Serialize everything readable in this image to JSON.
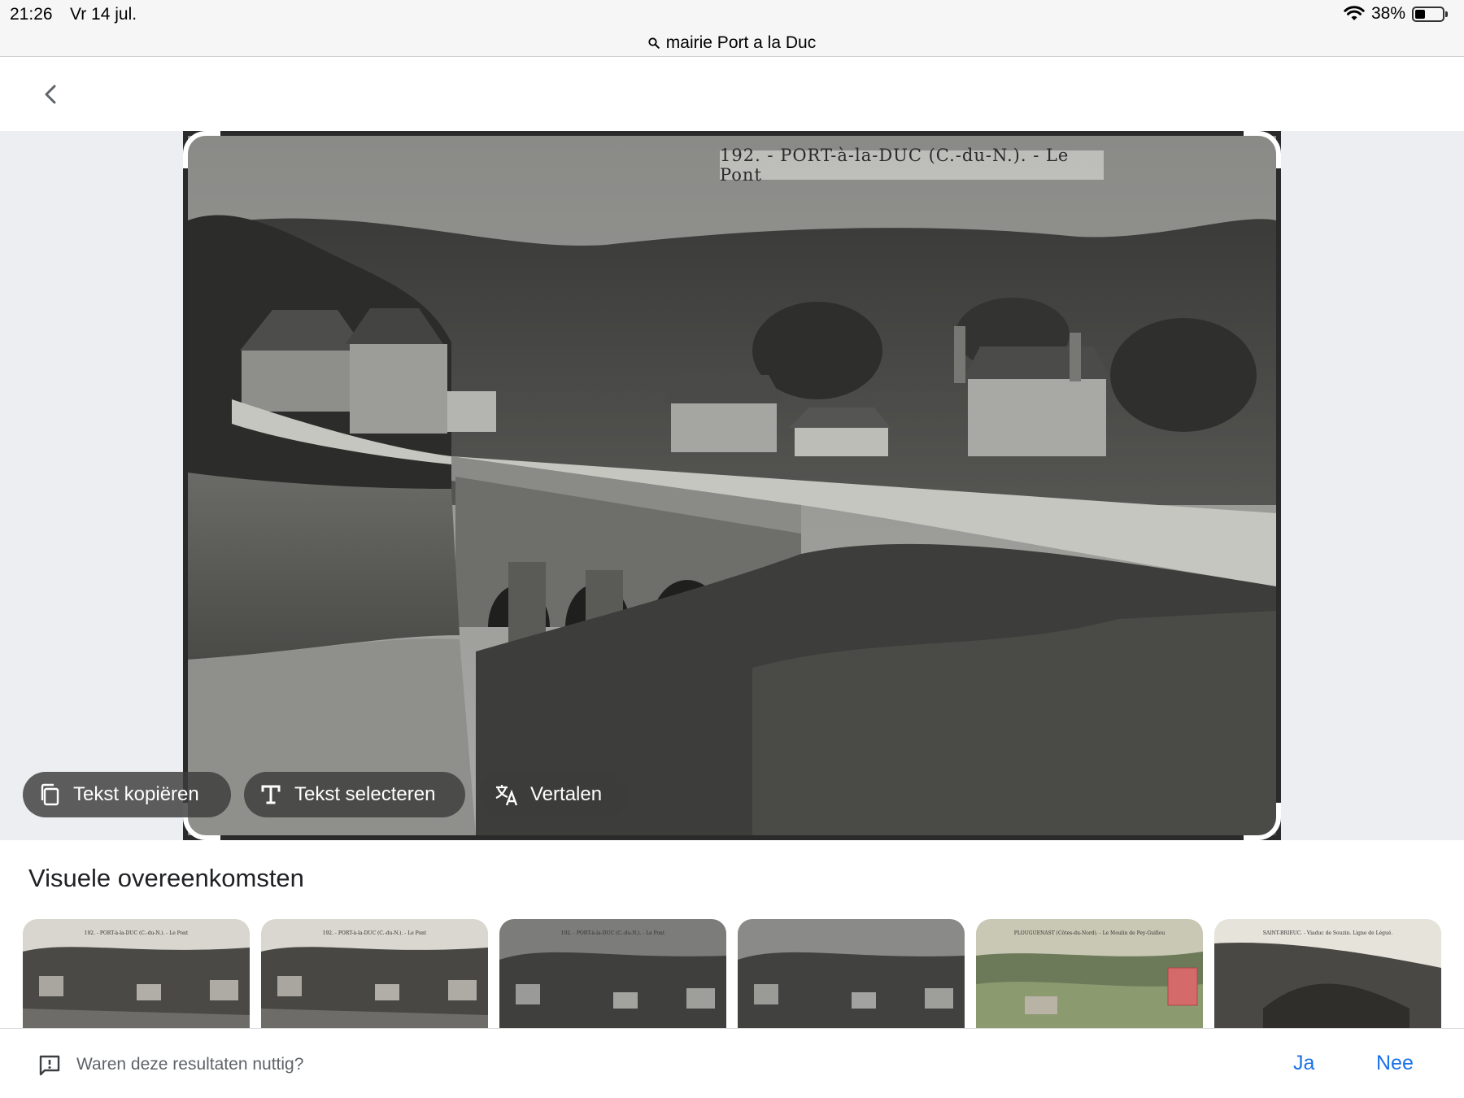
{
  "status_bar": {
    "time": "21:26",
    "date": "Vr 14 jul.",
    "battery_percent": "38%",
    "battery_level": 0.38,
    "wifi_icon": "wifi-icon",
    "battery_icon": "battery-icon"
  },
  "address_bar": {
    "search_icon": "search-icon",
    "query": "mairie Port a la Duc"
  },
  "nav": {
    "back_icon": "chevron-left-icon"
  },
  "viewer": {
    "image_caption": "192. - PORT-à-la-DUC (C.-du-N.). - Le Pont",
    "actions": [
      {
        "label": "Tekst kopiëren",
        "icon": "copy-icon"
      },
      {
        "label": "Tekst selecteren",
        "icon": "text-select-icon"
      },
      {
        "label": "Vertalen",
        "icon": "translate-icon"
      }
    ]
  },
  "matches": {
    "title": "Visuele overeenkomsten",
    "thumbnails": [
      {
        "caption": "192. - PORT-à-la-DUC (C.-du-N.). - Le Pont",
        "tone": "sepia"
      },
      {
        "caption": "192. - PORT-à-la-DUC (C.-du-N.). - Le Pont",
        "tone": "sepia"
      },
      {
        "caption": "192. - PORT-à-la-DUC (C.-du-N.). - Le Pont",
        "tone": "gray"
      },
      {
        "caption": "",
        "tone": "gray"
      },
      {
        "caption": "PLOUGUENAST (Côtes-du-Nord). - Le Moulin de Pey-Guillou",
        "tone": "color"
      },
      {
        "caption": "SAINT-BRIEUC. - Viaduc de Souzin. Ligne de Légué.",
        "tone": "sepia"
      }
    ]
  },
  "feedback": {
    "icon": "feedback-icon",
    "question": "Waren deze resultaten nuttig?",
    "yes_label": "Ja",
    "no_label": "Nee"
  },
  "colors": {
    "accent": "#1a73e8",
    "chip_background": "#3c3c3c",
    "viewer_background": "#eceef1"
  }
}
